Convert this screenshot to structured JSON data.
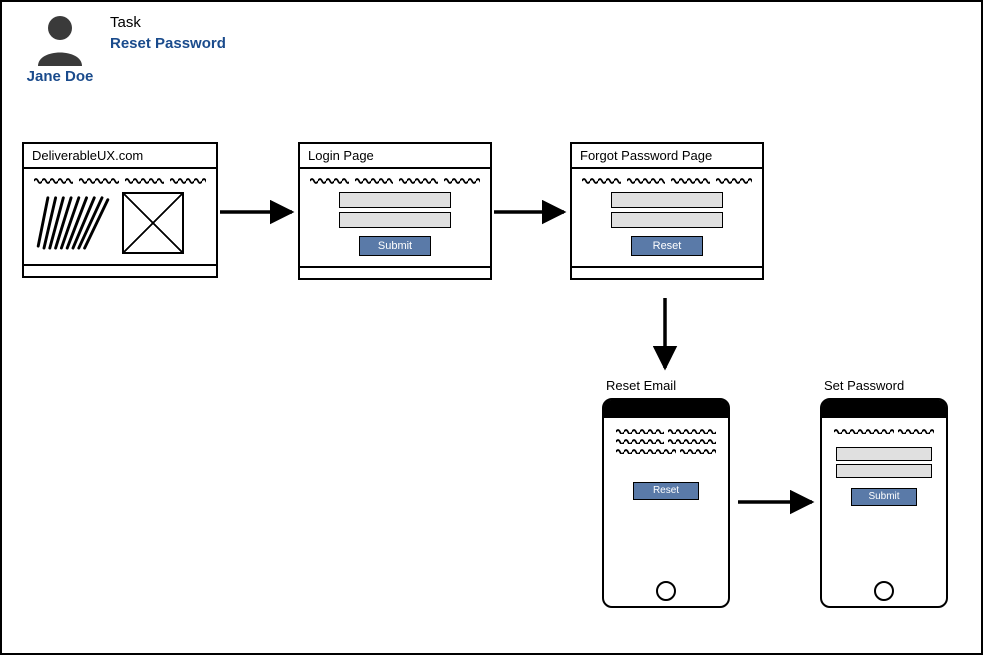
{
  "persona": {
    "name": "Jane Doe"
  },
  "task": {
    "label": "Task",
    "value": "Reset Password"
  },
  "screens": {
    "home": {
      "title": "DeliverableUX.com"
    },
    "login": {
      "title": "Login Page",
      "button": "Submit"
    },
    "forgot": {
      "title": "Forgot Password Page",
      "button": "Reset"
    }
  },
  "phones": {
    "email": {
      "title": "Reset Email",
      "button": "Reset"
    },
    "setpwd": {
      "title": "Set Password",
      "button": "Submit"
    }
  }
}
